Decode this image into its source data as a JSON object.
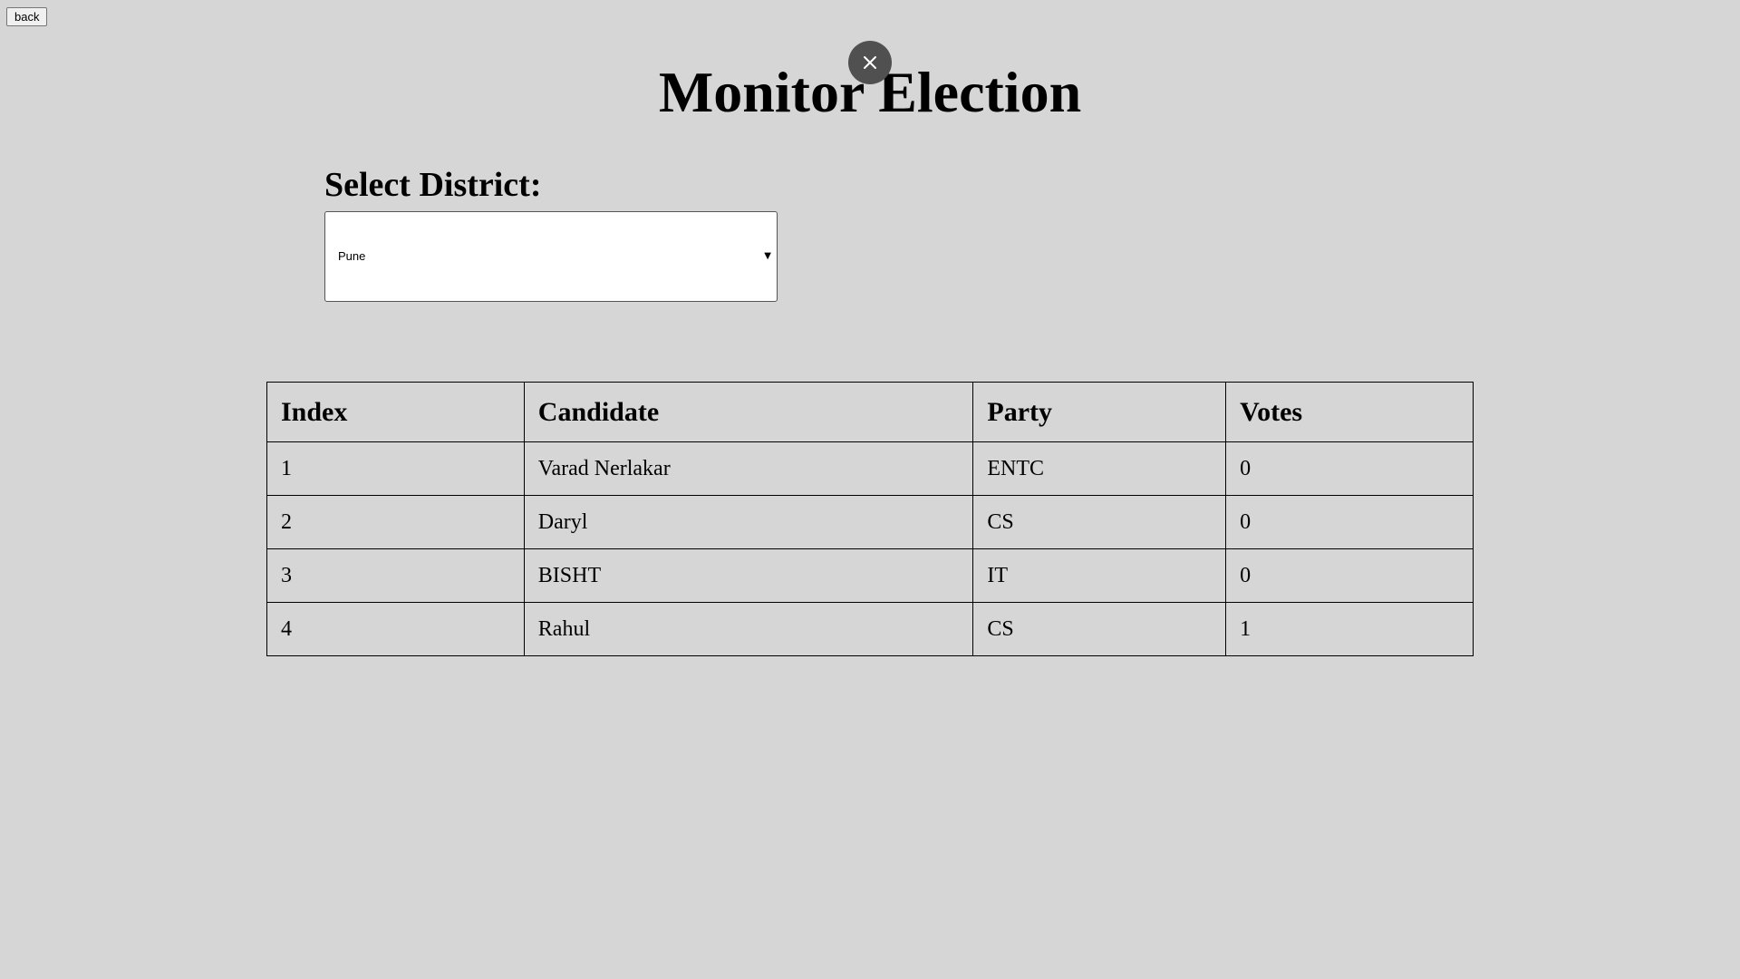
{
  "nav": {
    "back_label": "back"
  },
  "overlay": {
    "close_icon": "close-icon"
  },
  "header": {
    "title": "Monitor Election"
  },
  "district": {
    "label": "Select District:",
    "selected": "Pune"
  },
  "table": {
    "columns": [
      "Index",
      "Candidate",
      "Party",
      "Votes"
    ],
    "rows": [
      [
        "1",
        "Varad Nerlakar",
        "ENTC",
        "0"
      ],
      [
        "2",
        "Daryl",
        "CS",
        "0"
      ],
      [
        "3",
        "BISHT",
        "IT",
        "0"
      ],
      [
        "4",
        "Rahul",
        "CS",
        "1"
      ]
    ]
  },
  "colors": {
    "background": "#d6d6d6",
    "close_button": "#505050"
  }
}
